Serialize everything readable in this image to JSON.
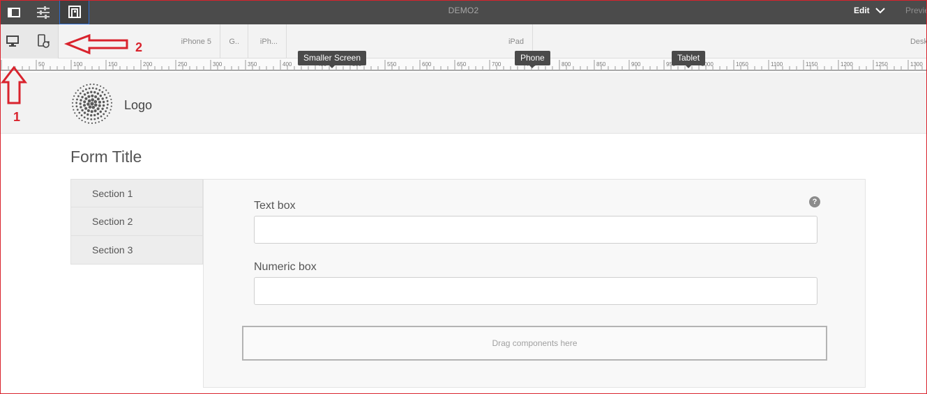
{
  "topbar": {
    "title": "DEMO2",
    "edit_label": "Edit",
    "preview_label": "Previe",
    "icons": [
      "side-panel-icon",
      "properties-sliders-icon",
      "emulator-icon",
      "chevron-down-icon"
    ]
  },
  "emulator": {
    "tools": [
      "desktop-icon",
      "rotate-device-icon"
    ],
    "devices": [
      {
        "label": "iPhone 5"
      },
      {
        "label": "G.."
      },
      {
        "label": "iPh..."
      },
      {
        "label": "iPad"
      },
      {
        "label": "Desk"
      }
    ]
  },
  "ruler": {
    "start": 0,
    "end": 1300,
    "step": 10,
    "label_step": 50,
    "breakpoints": [
      {
        "label": "Smaller Screen"
      },
      {
        "label": "Phone"
      },
      {
        "label": "Tablet"
      }
    ]
  },
  "page": {
    "logo_text": "Logo",
    "form_title": "Form Title",
    "sections": [
      "Section 1",
      "Section 2",
      "Section 3"
    ],
    "fields": {
      "text_box": {
        "label": "Text box",
        "value": ""
      },
      "numeric_box": {
        "label": "Numeric box",
        "value": ""
      }
    },
    "help_icon_glyph": "?",
    "drop_zone": "Drag components here"
  },
  "annotations": {
    "arrow_1_label": "1",
    "arrow_2_label": "2",
    "color": "#d9232d"
  }
}
